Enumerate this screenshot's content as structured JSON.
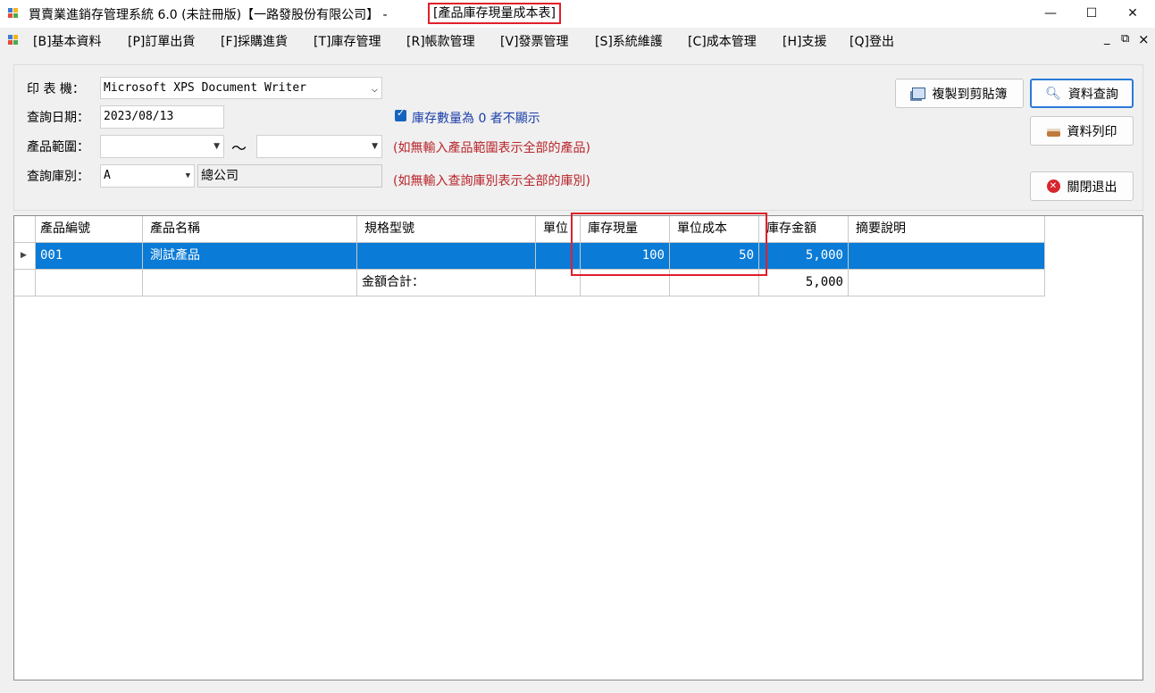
{
  "window": {
    "title_main": "買賣業進銷存管理系統 6.0 (未註冊版)【一路發股份有限公司】 -",
    "title_form": "[產品庫存現量成本表]",
    "minimize": "—",
    "maximize": "☐",
    "close": "✕"
  },
  "menu": {
    "items": [
      "[B]基本資料",
      "[P]訂單出貨",
      "[F]採購進貨",
      "[T]庫存管理",
      "[R]帳款管理",
      "[V]發票管理",
      "[S]系統維護",
      "[C]成本管理",
      "[H]支援",
      "[Q]登出"
    ],
    "child_min": "_",
    "child_restore": "⧉",
    "child_close": "×"
  },
  "form": {
    "printer_label": "印 表 機：",
    "printer_value": "Microsoft XPS Document Writer",
    "date_label": "查詢日期：",
    "date_value": "2023/08/13",
    "range_label": "產品範圍：",
    "range_from": "",
    "range_tilde": "～",
    "range_to": "",
    "warehouse_label": "查詢庫別：",
    "warehouse_code": "A",
    "warehouse_name": "總公司",
    "hide_zero_label": "庫存數量為 0 者不顯示",
    "hide_zero_checked": true,
    "range_hint": "(如無輸入產品範圍表示全部的產品)",
    "warehouse_hint": "(如無輸入查詢庫別表示全部的庫別)"
  },
  "buttons": {
    "copy": "複製到剪貼簿",
    "query": "資料查詢",
    "print": "資料列印",
    "exit": "關閉退出"
  },
  "grid": {
    "columns": [
      "產品編號",
      "產品名稱",
      "規格型號",
      "單位",
      "庫存現量",
      "單位成本",
      "庫存金額",
      "摘要說明"
    ],
    "rows": [
      {
        "code": "001",
        "name": "測試產品",
        "spec": "",
        "unit": "",
        "qty": "100",
        "cost": "50",
        "amount": "5,000",
        "note": ""
      }
    ],
    "total_label": "金額合計：",
    "total_amount": "5,000"
  },
  "colors": {
    "highlight_border": "#e0202a",
    "selected_row": "#0a7bd6",
    "hint_text": "#b8252b",
    "checkbox_text": "#1a3ea8"
  }
}
